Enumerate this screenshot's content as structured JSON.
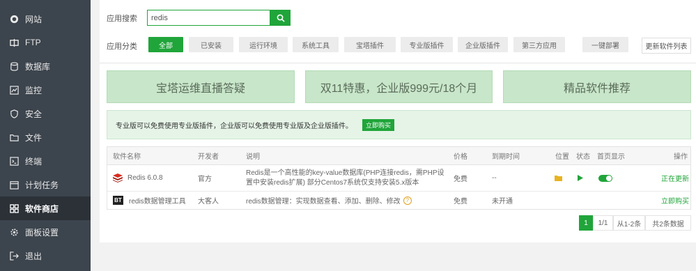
{
  "sidebar": {
    "items": [
      {
        "label": "网站",
        "icon": "globe-icon",
        "active": false
      },
      {
        "label": "FTP",
        "icon": "ftp-icon",
        "active": false
      },
      {
        "label": "数据库",
        "icon": "database-icon",
        "active": false
      },
      {
        "label": "监控",
        "icon": "monitor-icon",
        "active": false
      },
      {
        "label": "安全",
        "icon": "shield-icon",
        "active": false
      },
      {
        "label": "文件",
        "icon": "folder-icon",
        "active": false
      },
      {
        "label": "终端",
        "icon": "terminal-icon",
        "active": false
      },
      {
        "label": "计划任务",
        "icon": "calendar-icon",
        "active": false
      },
      {
        "label": "软件商店",
        "icon": "grid-icon",
        "active": true
      },
      {
        "label": "面板设置",
        "icon": "gear-icon",
        "active": false
      },
      {
        "label": "退出",
        "icon": "logout-icon",
        "active": false
      }
    ]
  },
  "search": {
    "label": "应用搜索",
    "value": "redis"
  },
  "categories": {
    "label": "应用分类",
    "items": [
      "全部",
      "已安装",
      "运行环境",
      "系统工具",
      "宝塔插件",
      "专业版插件",
      "企业版插件",
      "第三方应用",
      "一键部署"
    ],
    "active_index": 0,
    "update_list": "更新软件列表"
  },
  "banners": [
    "宝塔运维直播答疑",
    "双11特惠，企业版999元/18个月",
    "精品软件推荐"
  ],
  "notice": {
    "text": "专业版可以免费使用专业版插件，企业版可以免费使用专业版及企业版插件。",
    "button": "立即购买"
  },
  "table": {
    "headers": {
      "name": "软件名称",
      "developer": "开发者",
      "desc": "说明",
      "price": "价格",
      "expire": "到期时间",
      "location": "位置",
      "status": "状态",
      "homepage": "首页显示",
      "op": "操作"
    },
    "rows": [
      {
        "name": "Redis 6.0.8",
        "developer": "官方",
        "desc": "Redis是一个高性能的key-value数据库(PHP连接redis，需PHP设置中安装redis扩展) 部分Centos7系统仅支持安装5.x版本",
        "price": "免费",
        "expire": "--",
        "op": "正在更新"
      },
      {
        "name": "redis数据管理工具",
        "developer": "大客人",
        "desc": "redis数据管理：实现数据查看、添加、删除、修改",
        "price": "免费",
        "expire": "未开通",
        "op": "立即购买"
      }
    ]
  },
  "pagination": {
    "current": "1",
    "page_info": "1/1",
    "range": "从1-2条",
    "total": "共2条数据"
  },
  "colors": {
    "accent": "#20a53a",
    "sidebar_bg": "#3c444d",
    "sidebar_active": "#2c3138"
  }
}
